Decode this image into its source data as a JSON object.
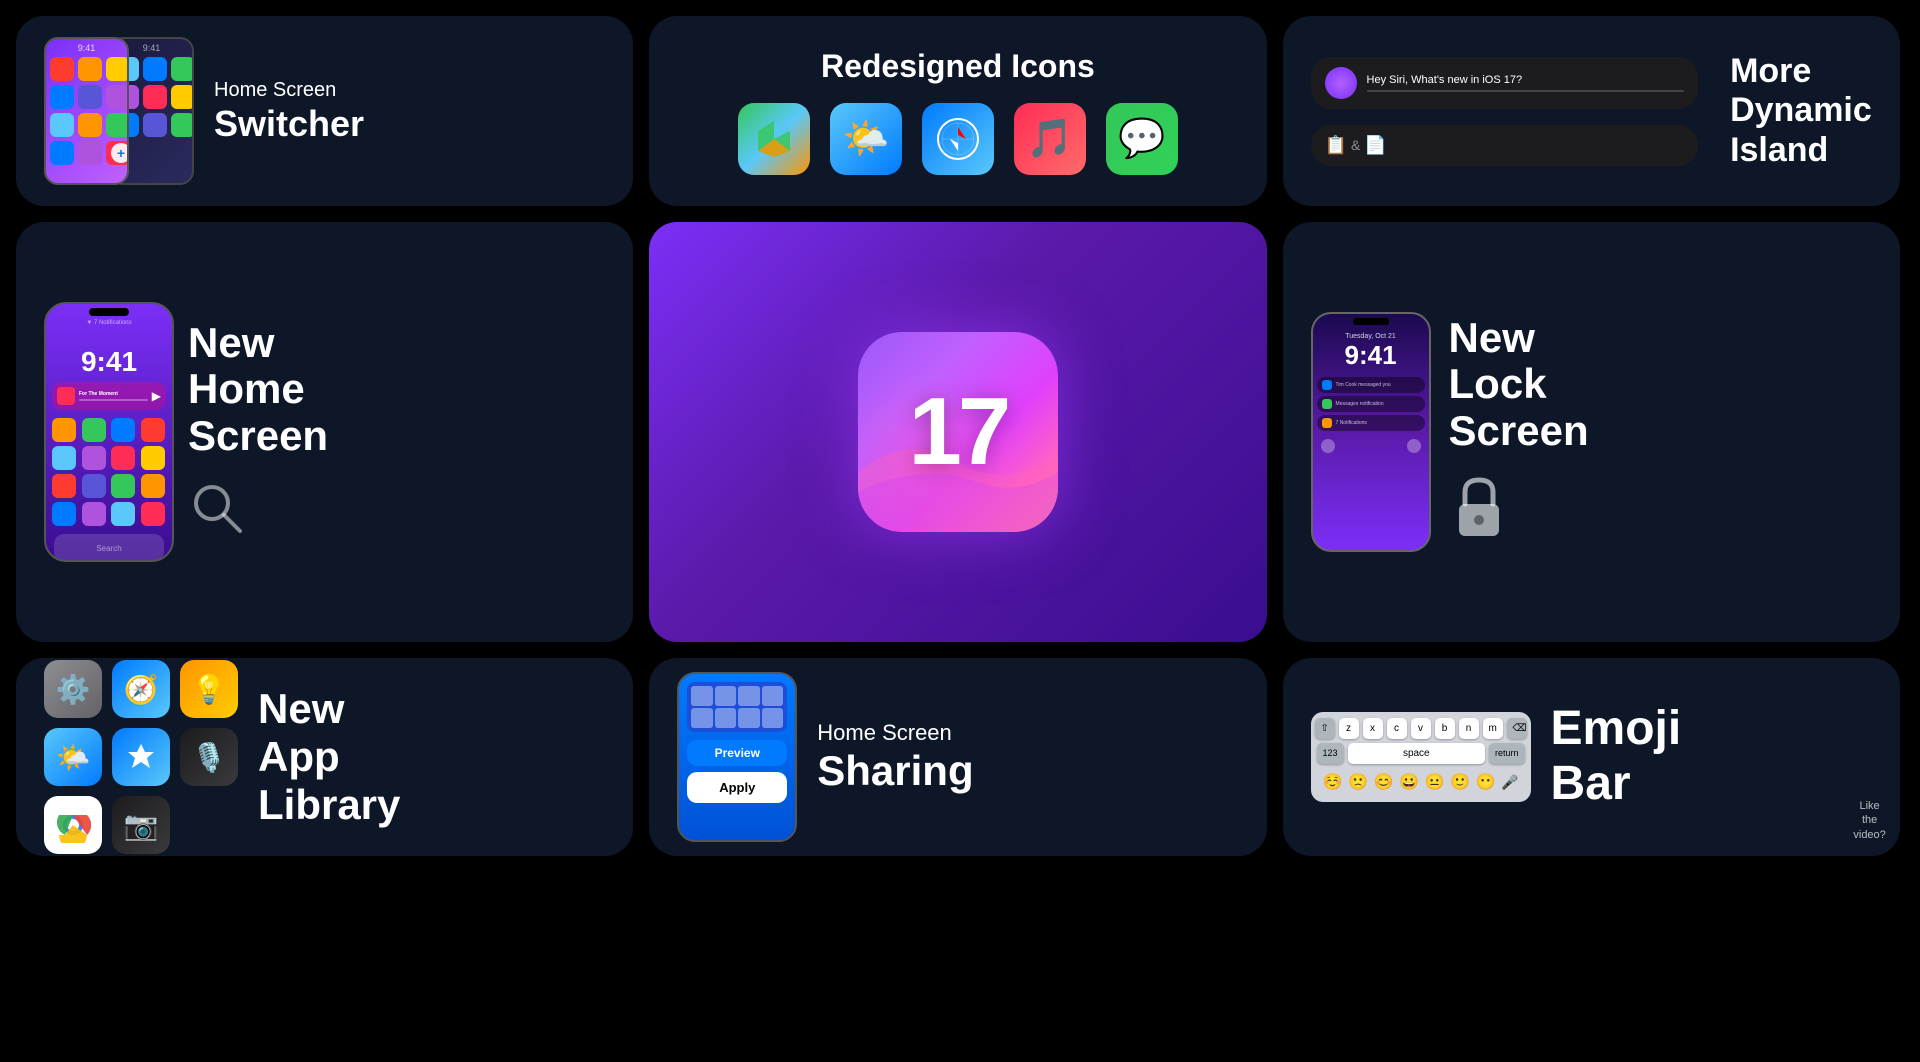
{
  "colors": {
    "background": "#000000",
    "cardBg": "#0d1728",
    "accent": "#7b2ff7"
  },
  "cards": {
    "homeSwitcher": {
      "line1": "Home Screen",
      "line2": "Switcher"
    },
    "redesignedIcons": {
      "title": "Redesigned Icons",
      "icons": [
        "🗺️",
        "🌤️",
        "🧭",
        "🎵",
        "💬"
      ]
    },
    "dynamicIsland": {
      "line1": "More",
      "line2": "Dynamic",
      "line3": "Island",
      "siriText": "Hey Siri, What's new in iOS 17?",
      "ampersand": "&"
    },
    "newHomeScreen": {
      "line1": "New",
      "line2": "Home",
      "line3": "Screen",
      "time": "9:41",
      "notification": "▼ 7 Notifications"
    },
    "ios17Center": {
      "number": "17"
    },
    "newLockScreen": {
      "line1": "New",
      "line2": "Lock",
      "line3": "Screen",
      "date": "Tuesday, Oct 21",
      "time": "9:41"
    },
    "appLibrary": {
      "line1": "New",
      "line2": "App",
      "line3": "Library"
    },
    "homeSharing": {
      "line1": "Home Screen",
      "line2": "Sharing",
      "previewLabel": "Preview",
      "applyLabel": "Apply"
    },
    "emojiBar": {
      "line1": "Emoji",
      "line2": "Bar",
      "keys": {
        "row1": [
          "z",
          "x",
          "c",
          "v",
          "b",
          "n",
          "m"
        ],
        "row2": [
          "123",
          "space",
          "return"
        ],
        "shiftKey": "⇧",
        "deleteKey": "⌫",
        "emojis": [
          "🙁",
          "😊",
          "😀",
          "😐",
          "🙂",
          "😶"
        ]
      }
    }
  },
  "likeBadge": {
    "line1": "Like",
    "line2": "the",
    "line3": "video?"
  }
}
